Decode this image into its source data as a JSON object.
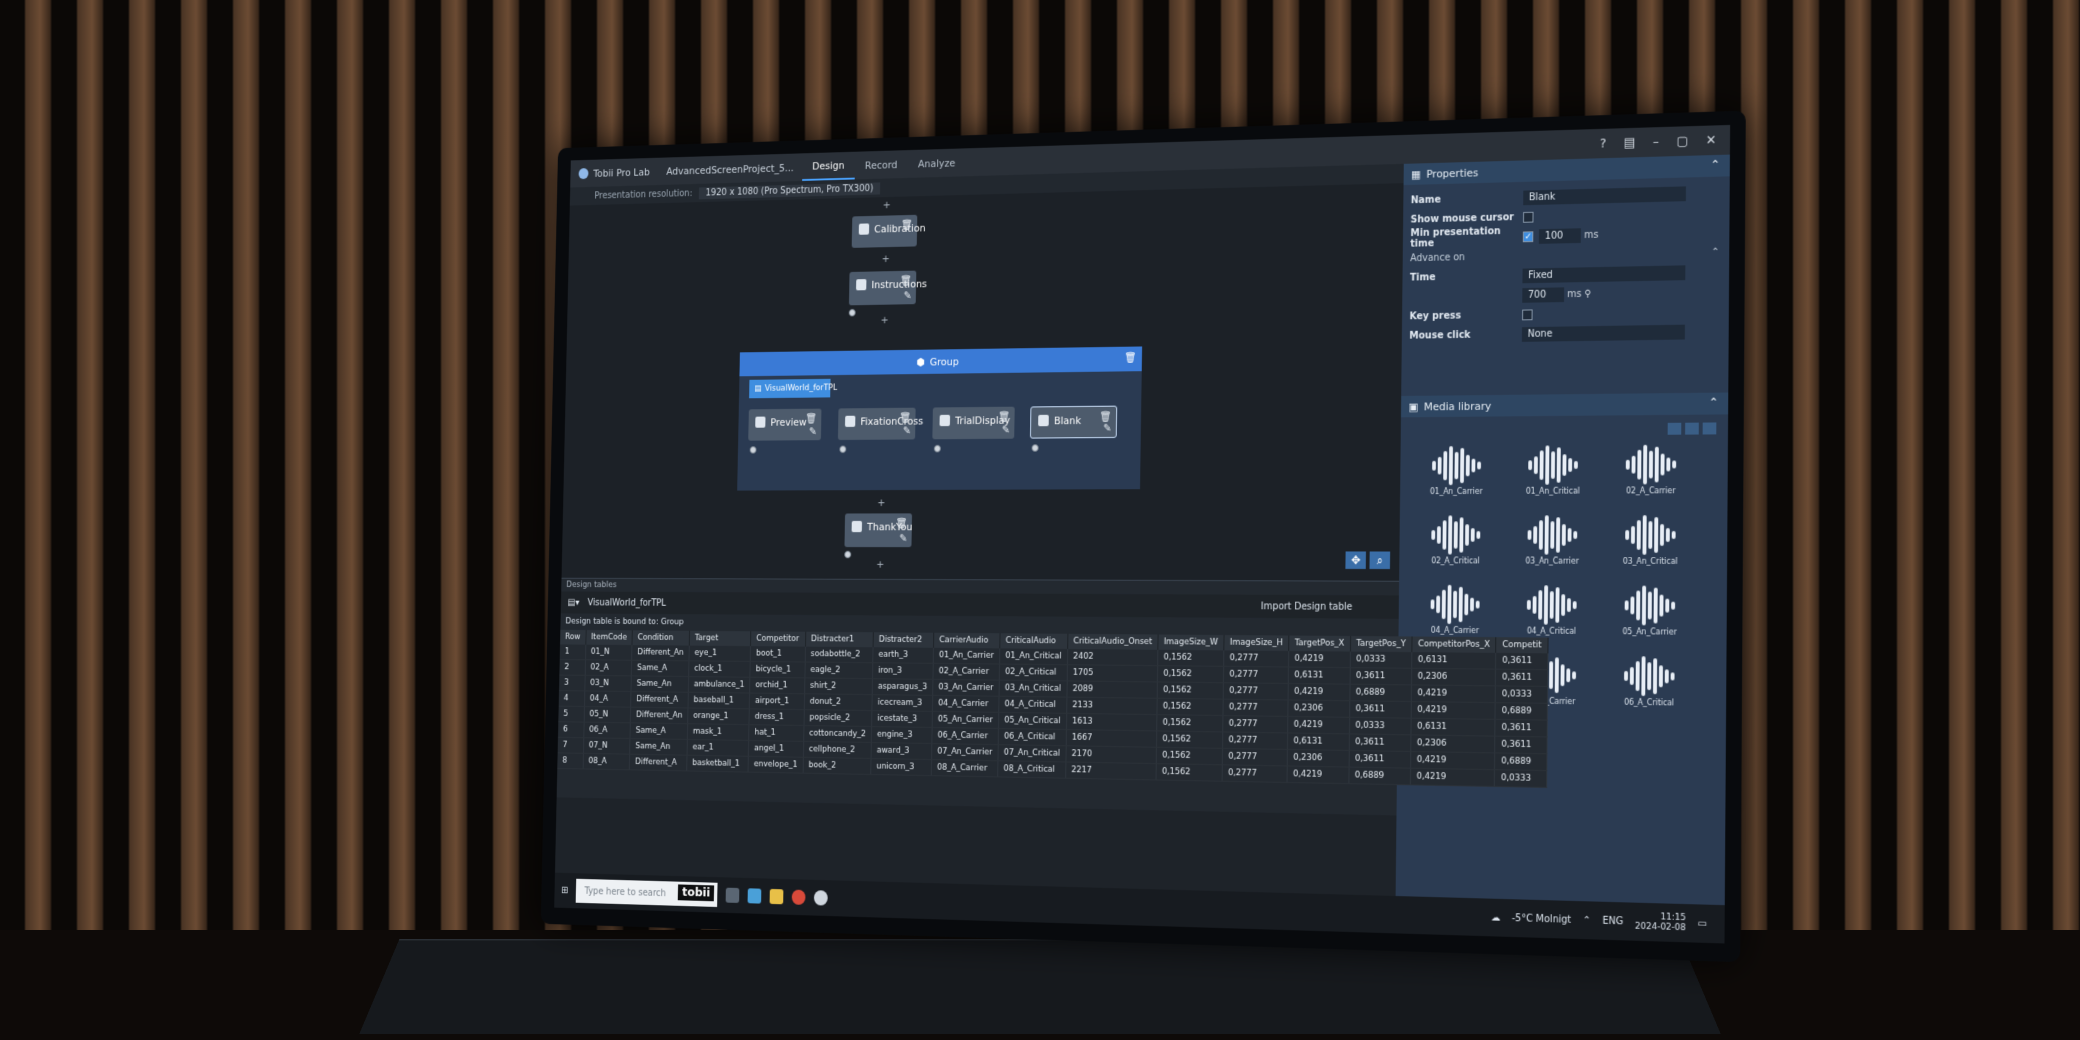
{
  "titlebar": {
    "app": "Tobii Pro Lab",
    "project": "AdvancedScreenProject_5...",
    "tabs": [
      "Design",
      "Record",
      "Analyze"
    ],
    "active_tab": "Design"
  },
  "resolution": {
    "label": "Presentation resolution:",
    "value": "1920 x 1080 (Pro Spectrum, Pro TX300)"
  },
  "nodes": {
    "calibration": "Calibration",
    "instructions": "Instructions",
    "group": "Group",
    "group_table": "VisualWorld_forTPL",
    "preview": "Preview",
    "fixation": "FixationCross",
    "trial": "TrialDisplay",
    "blank": "Blank",
    "thankyou": "ThankYou"
  },
  "properties": {
    "title": "Properties",
    "name_label": "Name",
    "name_value": "Blank",
    "show_cursor_label": "Show mouse cursor",
    "min_time_label": "Min presentation time",
    "min_time_value": "100",
    "ms": "ms",
    "advance_on": "Advance on",
    "time_label": "Time",
    "time_value": "Fixed",
    "time_ms": "700",
    "key_press_label": "Key press",
    "mouse_click_label": "Mouse click",
    "mouse_click_value": "None"
  },
  "media": {
    "title": "Media library",
    "items": [
      "01_An_Carrier",
      "01_An_Critical",
      "02_A_Carrier",
      "02_A_Critical",
      "03_An_Carrier",
      "03_An_Critical",
      "04_A_Carrier",
      "04_A_Critical",
      "05_An_Carrier",
      "05_An_Critical",
      "06_A_Carrier",
      "06_A_Critical"
    ]
  },
  "design_table": {
    "section": "Design tables",
    "name": "VisualWorld_forTPL",
    "import": "Import Design table",
    "bound": "Design table is bound to: Group",
    "columns": [
      "Row",
      "ItemCode",
      "Condition",
      "Target",
      "Competitor",
      "Distracter1",
      "Distracter2",
      "CarrierAudio",
      "CriticalAudio",
      "CriticalAudio_Onset",
      "ImageSize_W",
      "ImageSize_H",
      "TargetPos_X",
      "TargetPos_Y",
      "CompetitorPos_X",
      "Competit"
    ],
    "rows": [
      [
        "1",
        "01_N",
        "Different_An",
        "eye_1",
        "boot_1",
        "sodabottle_2",
        "earth_3",
        "01_An_Carrier",
        "01_An_Critical",
        "2402",
        "0,1562",
        "0,2777",
        "0,4219",
        "0,0333",
        "0,6131",
        "0,3611"
      ],
      [
        "2",
        "02_A",
        "Same_A",
        "clock_1",
        "bicycle_1",
        "eagle_2",
        "iron_3",
        "02_A_Carrier",
        "02_A_Critical",
        "1705",
        "0,1562",
        "0,2777",
        "0,6131",
        "0,3611",
        "0,2306",
        "0,3611"
      ],
      [
        "3",
        "03_N",
        "Same_An",
        "ambulance_1",
        "orchid_1",
        "shirt_2",
        "asparagus_3",
        "03_An_Carrier",
        "03_An_Critical",
        "2089",
        "0,1562",
        "0,2777",
        "0,4219",
        "0,6889",
        "0,4219",
        "0,0333"
      ],
      [
        "4",
        "04_A",
        "Different_A",
        "baseball_1",
        "airport_1",
        "donut_2",
        "icecream_3",
        "04_A_Carrier",
        "04_A_Critical",
        "2133",
        "0,1562",
        "0,2777",
        "0,2306",
        "0,3611",
        "0,4219",
        "0,6889"
      ],
      [
        "5",
        "05_N",
        "Different_An",
        "orange_1",
        "dress_1",
        "popsicle_2",
        "icestate_3",
        "05_An_Carrier",
        "05_An_Critical",
        "1613",
        "0,1562",
        "0,2777",
        "0,4219",
        "0,0333",
        "0,6131",
        "0,3611"
      ],
      [
        "6",
        "06_A",
        "Same_A",
        "mask_1",
        "hat_1",
        "cottoncandy_2",
        "engine_3",
        "06_A_Carrier",
        "06_A_Critical",
        "1667",
        "0,1562",
        "0,2777",
        "0,6131",
        "0,3611",
        "0,2306",
        "0,3611"
      ],
      [
        "7",
        "07_N",
        "Same_An",
        "ear_1",
        "angel_1",
        "cellphone_2",
        "award_3",
        "07_An_Carrier",
        "07_An_Critical",
        "2170",
        "0,1562",
        "0,2777",
        "0,2306",
        "0,3611",
        "0,4219",
        "0,6889"
      ],
      [
        "8",
        "08_A",
        "Different_A",
        "basketball_1",
        "envelope_1",
        "book_2",
        "unicorn_3",
        "08_A_Carrier",
        "08_A_Critical",
        "2217",
        "0,1562",
        "0,2777",
        "0,4219",
        "0,6889",
        "0,4219",
        "0,0333"
      ]
    ]
  },
  "taskbar": {
    "search": "Type here to search",
    "tobii": "tobii",
    "weather": "-5°C Molnigt",
    "lang": "ENG",
    "time": "11:15",
    "date": "2024-02-08"
  }
}
